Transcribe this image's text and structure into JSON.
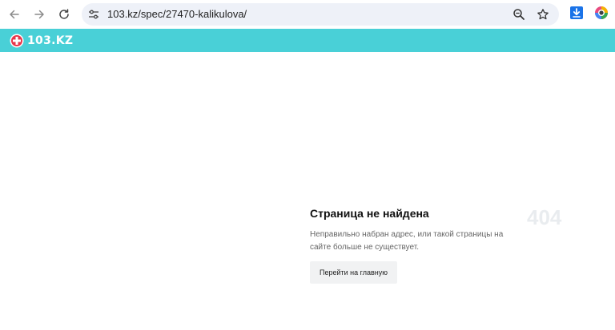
{
  "browser": {
    "url": "103.kz/spec/27470-kalikulova/",
    "icons": {
      "back": "arrow-left-icon",
      "forward": "arrow-right-icon",
      "reload": "reload-icon",
      "site_info": "tune-icon",
      "zoom": "zoom-icon",
      "bookmark": "star-icon",
      "download_extension": "download-icon",
      "color_extension": "color-picker-icon"
    },
    "colors": {
      "omnibox_bg": "#eef1f8",
      "download_blue": "#1a73e8"
    }
  },
  "site": {
    "logo_text": "103.KZ",
    "header_color": "#49d0d7",
    "logo_icon": "medical-cross-icon"
  },
  "error": {
    "title": "Страница не найдена",
    "code": "404",
    "description": "Неправильно набран адрес, или такой страницы на сайте больше не существует.",
    "home_button_label": "Перейти на главную"
  }
}
